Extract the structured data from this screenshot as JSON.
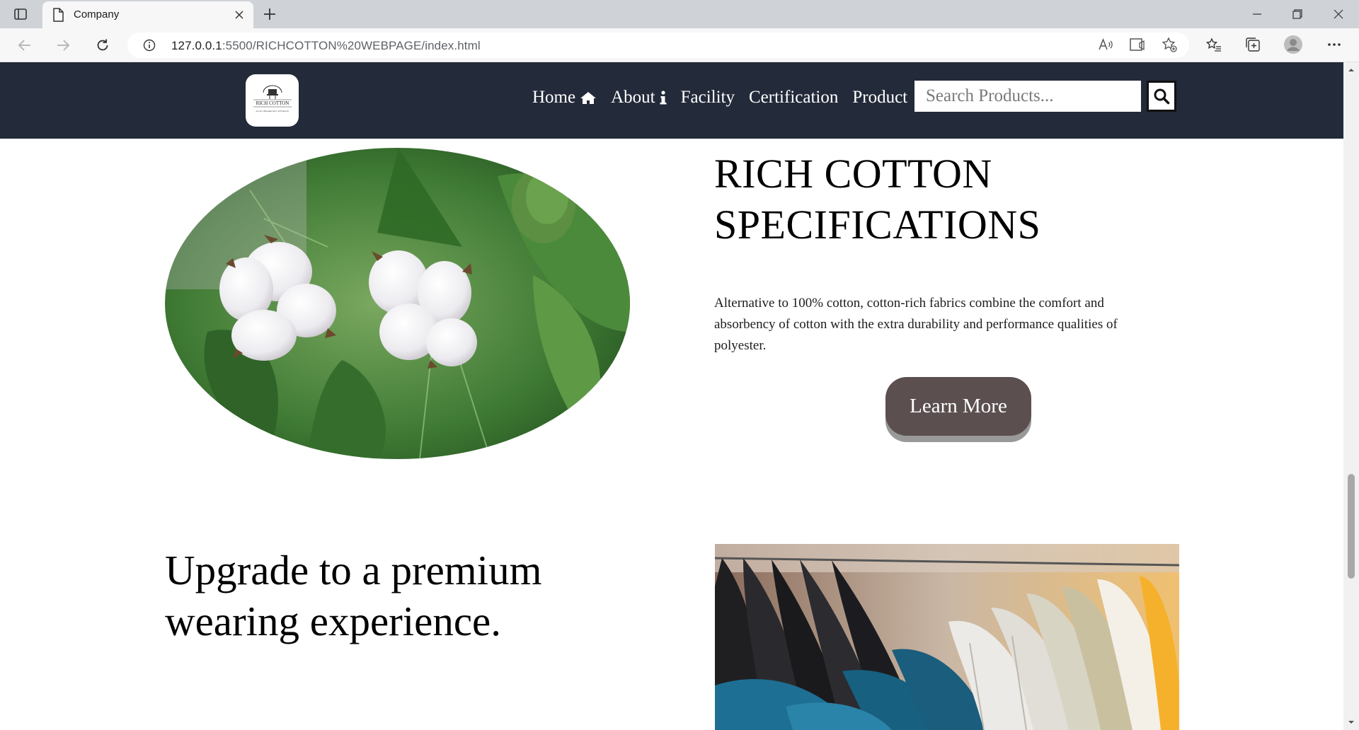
{
  "browser": {
    "tab_title": "Company",
    "url_host": "127.0.0.1",
    "url_rest": ":5500/RICHCOTTON%20WEBPAGE/index.html"
  },
  "site": {
    "logo_text": "RICH COTTON",
    "logo_tagline": "Luxury Manufacturer & Exporter",
    "nav": [
      {
        "label": "Home",
        "icon": "home-icon"
      },
      {
        "label": "About",
        "icon": "info-icon"
      },
      {
        "label": "Facility"
      },
      {
        "label": "Certification"
      },
      {
        "label": "Product"
      }
    ],
    "search": {
      "placeholder": "Search Products..."
    }
  },
  "hero": {
    "title": "RICH COTTON SPECIFICATIONS",
    "text": "Alternative to 100% cotton, cotton-rich fabrics combine the comfort and absorbency of cotton with the extra durability and performance qualities of polyester.",
    "button": "Learn More"
  },
  "promo": {
    "title": "Upgrade to a premium wearing experience."
  },
  "colors": {
    "nav_bg": "#232a3a",
    "button_bg": "#5b4f50",
    "button_shadow": "#999999"
  }
}
